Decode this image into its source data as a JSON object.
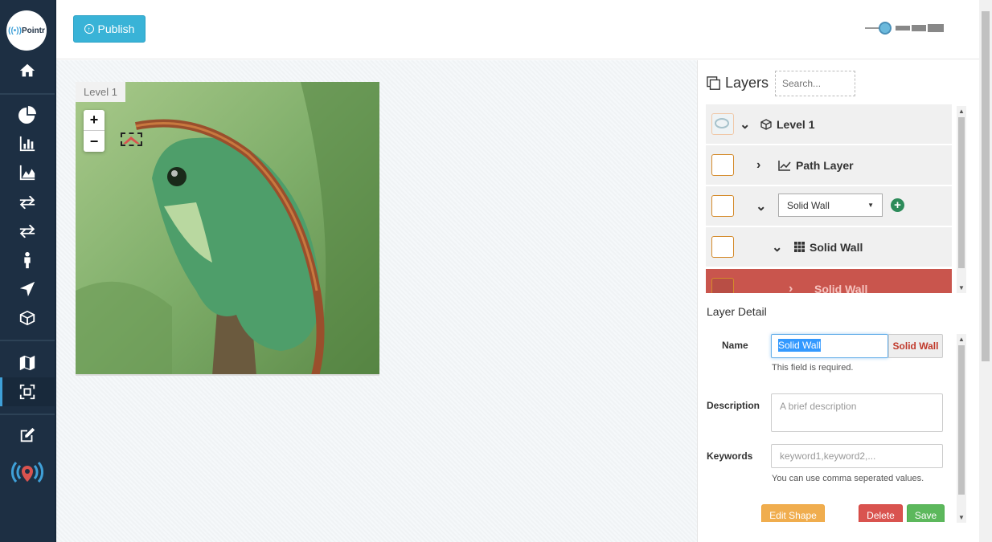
{
  "app": {
    "logo_text": "Pointr"
  },
  "sidebar": {
    "items": [
      {
        "name": "home-icon"
      },
      {
        "name": "pie-chart-icon"
      },
      {
        "name": "bar-chart-icon"
      },
      {
        "name": "area-chart-icon"
      },
      {
        "name": "exchange-icon"
      },
      {
        "name": "exchange-icon"
      },
      {
        "name": "person-icon"
      },
      {
        "name": "location-arrow-icon"
      },
      {
        "name": "cube-icon"
      },
      {
        "name": "map-icon"
      },
      {
        "name": "floorplan-icon"
      },
      {
        "name": "edit-icon"
      },
      {
        "name": "beacon-signal-icon"
      }
    ],
    "active_index": 10,
    "colors": {
      "background": "#1d2f43",
      "accent": "#3fa0d8"
    }
  },
  "toolbar": {
    "publish_label": "Publish"
  },
  "canvas": {
    "level_tab": "Level 1",
    "zoom_in": "+",
    "zoom_out": "−"
  },
  "layers": {
    "title": "Layers",
    "search_placeholder": "Search...",
    "rows": [
      {
        "label": "Level 1",
        "icon": "cube-outline-icon",
        "expanded": true
      },
      {
        "label": "Path Layer",
        "icon": "line-chart-icon",
        "expanded": false
      },
      {
        "select_value": "Solid Wall",
        "expanded": true
      },
      {
        "label": "Solid Wall",
        "icon": "grid-icon",
        "expanded": true
      },
      {
        "label": "Solid Wall",
        "selected": true
      }
    ]
  },
  "detail": {
    "title": "Layer Detail",
    "name_label": "Name",
    "name_value": "Solid Wall",
    "name_addon": "Solid Wall",
    "name_help": "This field is required.",
    "description_label": "Description",
    "description_placeholder": "A brief description",
    "keywords_label": "Keywords",
    "keywords_placeholder": "keyword1,keyword2,...",
    "keywords_help": "You can use comma seperated values.",
    "edit_shape_label": "Edit Shape",
    "delete_label": "Delete",
    "save_label": "Save"
  }
}
